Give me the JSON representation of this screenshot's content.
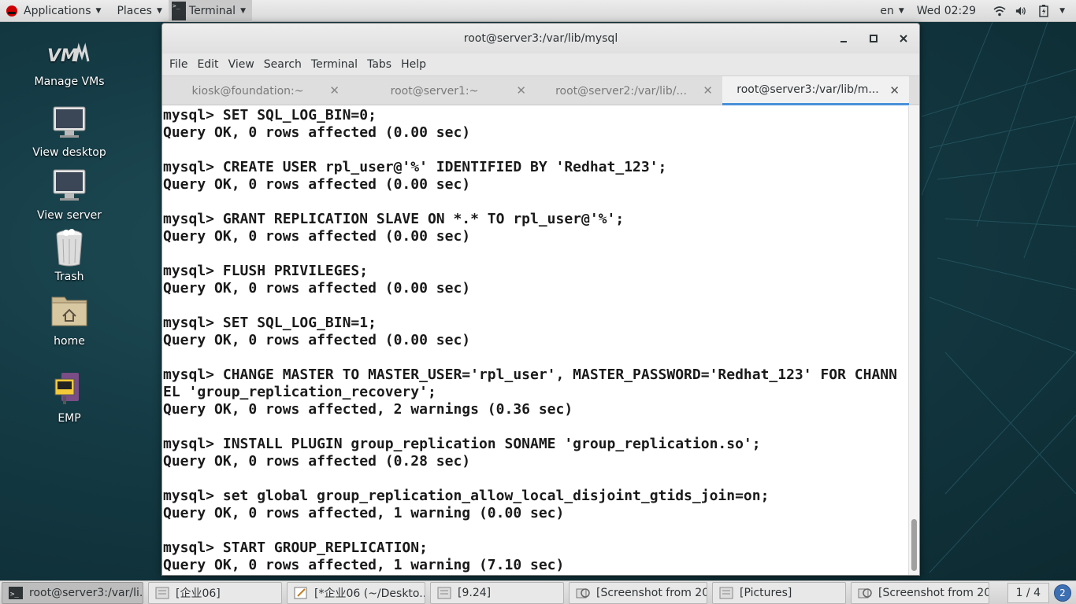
{
  "top_panel": {
    "applications": "Applications",
    "places": "Places",
    "terminal": "Terminal",
    "language": "en",
    "clock": "Wed 02:29"
  },
  "desktop_icons": [
    {
      "label": "Manage VMs",
      "icon": "vmm-icon"
    },
    {
      "label": "View desktop",
      "icon": "monitor-icon"
    },
    {
      "label": "View server",
      "icon": "monitor-icon"
    },
    {
      "label": "Trash",
      "icon": "trash-icon"
    },
    {
      "label": "home",
      "icon": "home-folder-icon"
    },
    {
      "label": "EMP",
      "icon": "emp-icon"
    }
  ],
  "window": {
    "title": "root@server3:/var/lib/mysql",
    "menu": [
      "File",
      "Edit",
      "View",
      "Search",
      "Terminal",
      "Tabs",
      "Help"
    ],
    "tabs": [
      {
        "label": "kiosk@foundation:~",
        "active": false
      },
      {
        "label": "root@server1:~",
        "active": false
      },
      {
        "label": "root@server2:/var/lib/...",
        "active": false
      },
      {
        "label": "root@server3:/var/lib/m...",
        "active": true
      }
    ]
  },
  "terminal_lines": [
    "mysql> SET SQL_LOG_BIN=0;",
    "Query OK, 0 rows affected (0.00 sec)",
    "",
    "mysql> CREATE USER rpl_user@'%' IDENTIFIED BY 'Redhat_123';",
    "Query OK, 0 rows affected (0.00 sec)",
    "",
    "mysql> GRANT REPLICATION SLAVE ON *.* TO rpl_user@'%';",
    "Query OK, 0 rows affected (0.00 sec)",
    "",
    "mysql> FLUSH PRIVILEGES;",
    "Query OK, 0 rows affected (0.00 sec)",
    "",
    "mysql> SET SQL_LOG_BIN=1;",
    "Query OK, 0 rows affected (0.00 sec)",
    "",
    "mysql> CHANGE MASTER TO MASTER_USER='rpl_user', MASTER_PASSWORD='Redhat_123' FOR CHANN",
    "EL 'group_replication_recovery';",
    "Query OK, 0 rows affected, 2 warnings (0.36 sec)",
    "",
    "mysql> INSTALL PLUGIN group_replication SONAME 'group_replication.so';",
    "Query OK, 0 rows affected (0.28 sec)",
    "",
    "mysql> set global group_replication_allow_local_disjoint_gtids_join=on;",
    "Query OK, 0 rows affected, 1 warning (0.00 sec)",
    "",
    "mysql> START GROUP_REPLICATION;",
    "Query OK, 0 rows affected, 1 warning (7.10 sec)"
  ],
  "taskbar": {
    "tasks": [
      {
        "label": "root@server3:/var/li...",
        "icon": "terminal-icon",
        "active": true
      },
      {
        "label": "[企业06]",
        "icon": "file-manager-icon",
        "active": false
      },
      {
        "label": "[*企业06 (~/Deskto...",
        "icon": "text-editor-icon",
        "active": false
      },
      {
        "label": "[9.24]",
        "icon": "file-manager-icon",
        "active": false
      },
      {
        "label": "[Screenshot from 20...",
        "icon": "screenshot-icon",
        "active": false
      },
      {
        "label": "[Pictures]",
        "icon": "file-manager-icon",
        "active": false
      },
      {
        "label": "[Screenshot from 20...",
        "icon": "screenshot-icon",
        "active": false
      }
    ],
    "workspace": "1 / 4",
    "notifications": "2"
  }
}
